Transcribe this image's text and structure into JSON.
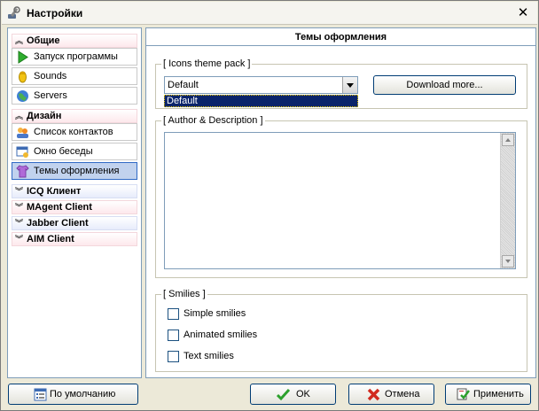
{
  "window": {
    "title": "Настройки",
    "close_glyph": "✕"
  },
  "nav": {
    "groups": [
      {
        "label": "Общие",
        "expanded": true,
        "items": [
          {
            "label": "Запуск программы",
            "icon": "play-icon"
          },
          {
            "label": "Sounds",
            "icon": "sound-icon"
          },
          {
            "label": "Servers",
            "icon": "globe-icon"
          }
        ]
      },
      {
        "label": "Дизайн",
        "expanded": true,
        "items": [
          {
            "label": "Список контактов",
            "icon": "contacts-icon"
          },
          {
            "label": "Окно беседы",
            "icon": "chat-window-icon"
          },
          {
            "label": "Темы оформления",
            "icon": "theme-shirt-icon",
            "selected": true
          }
        ]
      },
      {
        "label": "ICQ Клиент",
        "expanded": false
      },
      {
        "label": "MAgent Client",
        "expanded": false
      },
      {
        "label": "Jabber Client",
        "expanded": false
      },
      {
        "label": "AIM Client",
        "expanded": false
      }
    ]
  },
  "pane": {
    "title": "Темы оформления",
    "icons_pack": {
      "group_label": "[ Icons theme pack ]",
      "selected": "Default",
      "options": [
        "Default"
      ],
      "download_button": "Download more..."
    },
    "author": {
      "group_label": "[ Author & Description ]",
      "text": ""
    },
    "smilies": {
      "group_label": "[ Smilies ]",
      "options": [
        {
          "label": "Simple smilies",
          "checked": false
        },
        {
          "label": "Animated smilies",
          "checked": false
        },
        {
          "label": "Text smilies",
          "checked": false
        }
      ]
    }
  },
  "buttons": {
    "defaults": "По умолчанию",
    "ok": "OK",
    "cancel": "Отмена",
    "apply": "Применить"
  },
  "colors": {
    "selection": "#0a246a",
    "nav_selected": "#c1d2ee",
    "border": "#7f9db9"
  }
}
